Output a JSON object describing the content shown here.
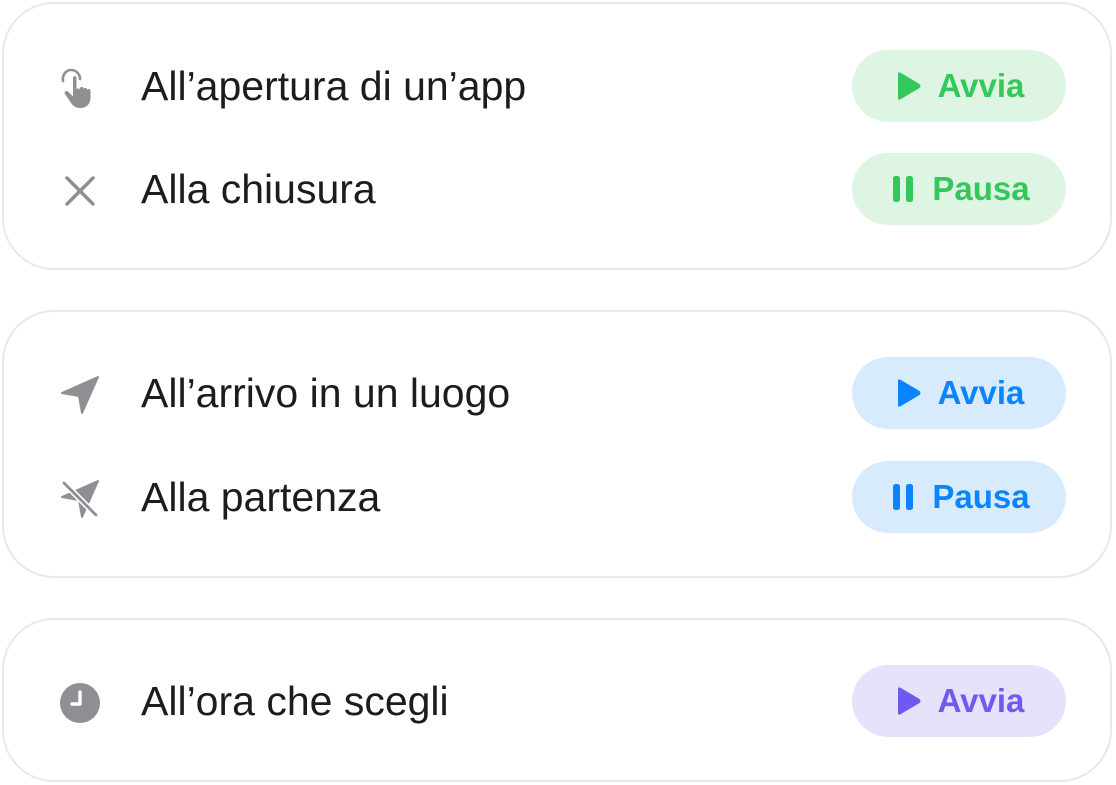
{
  "groups": [
    {
      "rows": [
        {
          "icon": "tap-hand-icon",
          "label": "All’apertura di un’app",
          "action": {
            "label": "Avvia",
            "icon": "play-icon",
            "color": "#34c759",
            "background": "#dff5e4"
          }
        },
        {
          "icon": "close-icon",
          "label": "Alla chiusura",
          "action": {
            "label": "Pausa",
            "icon": "pause-icon",
            "color": "#34c759",
            "background": "#dff5e4"
          }
        }
      ]
    },
    {
      "rows": [
        {
          "icon": "location-arrow-icon",
          "label": "All’arrivo in un luogo",
          "action": {
            "label": "Avvia",
            "icon": "play-icon",
            "color": "#0a84ff",
            "background": "#d8ebfc"
          }
        },
        {
          "icon": "location-slash-icon",
          "label": "Alla partenza",
          "action": {
            "label": "Pausa",
            "icon": "pause-icon",
            "color": "#0a84ff",
            "background": "#d8ebfc"
          }
        }
      ]
    },
    {
      "rows": [
        {
          "icon": "clock-icon",
          "label": "All’ora che scegli",
          "action": {
            "label": "Avvia",
            "icon": "play-icon",
            "color": "#6e5af0",
            "background": "#e6e2fc"
          }
        }
      ]
    }
  ],
  "colors": {
    "icon_gray": "#8e8e93",
    "text": "#1c1c1e",
    "card_border": "#e8e8ea"
  }
}
